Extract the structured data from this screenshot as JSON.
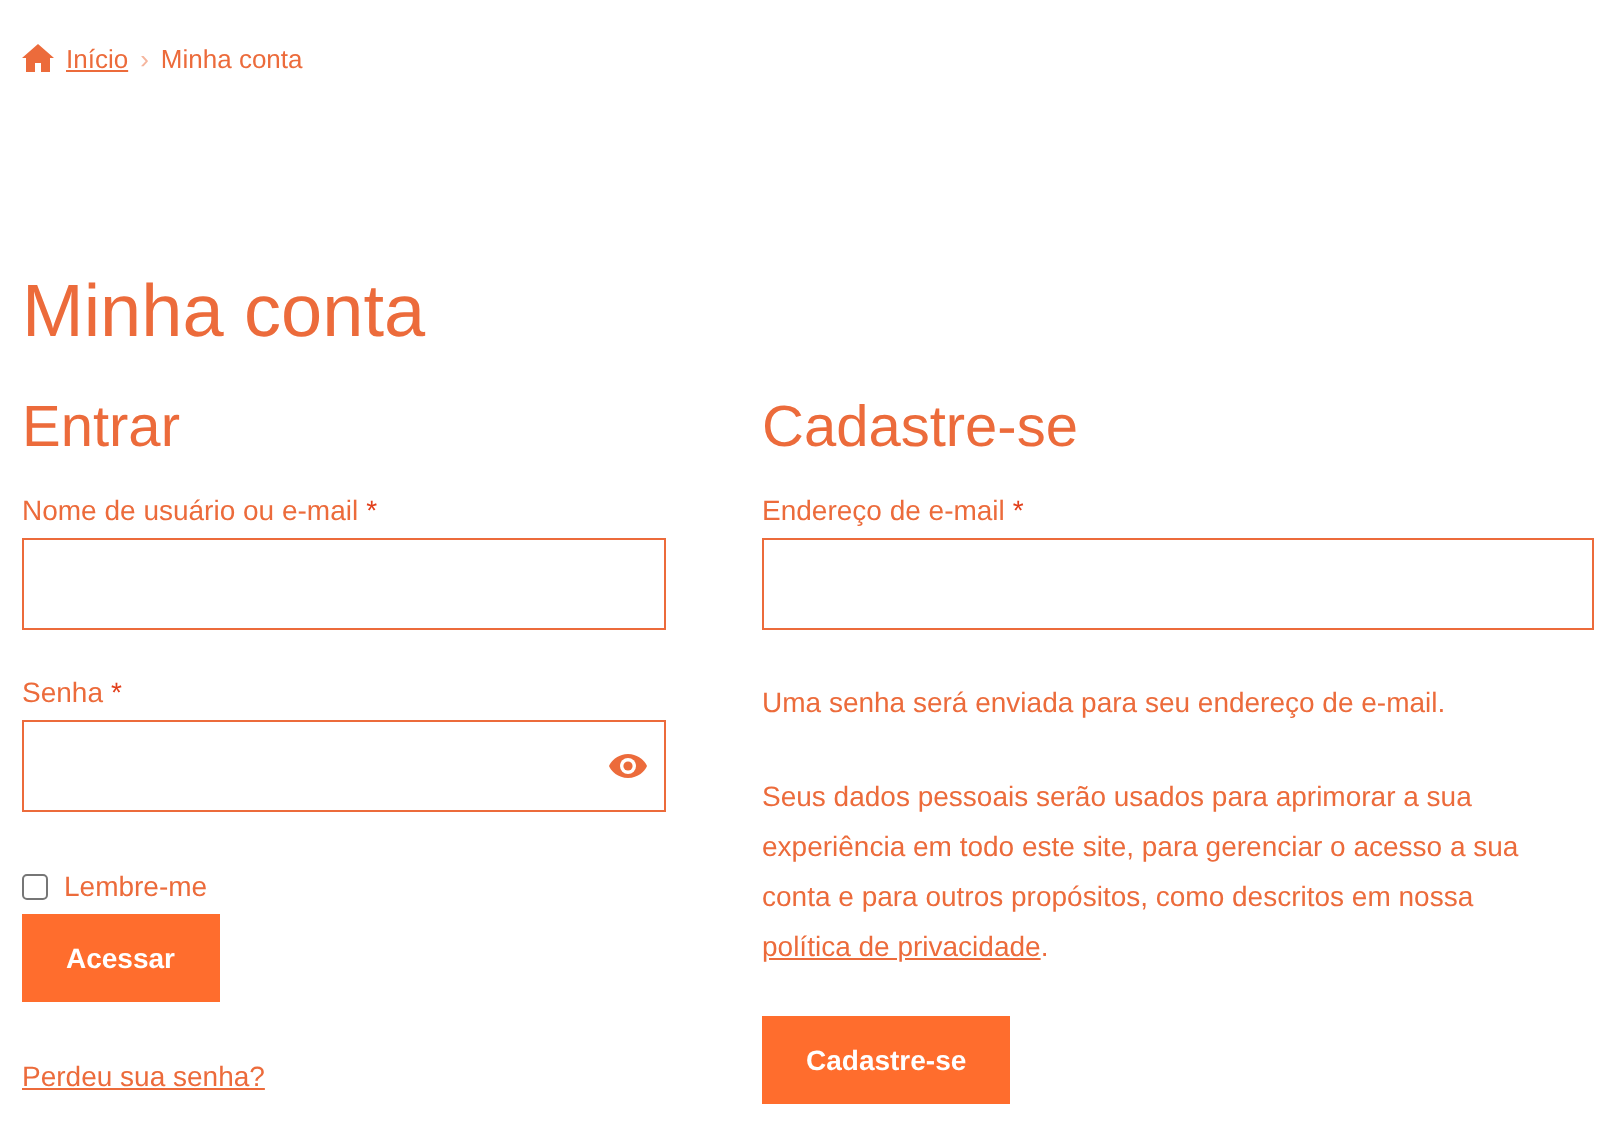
{
  "breadcrumb": {
    "home": "Início",
    "separator": "›",
    "current": "Minha conta"
  },
  "title": "Minha conta",
  "login": {
    "heading": "Entrar",
    "fields": [
      {
        "label": "Nome de usuário ou e-mail",
        "required_mark": "*",
        "kind": "text"
      },
      {
        "label": "Senha",
        "required_mark": "*",
        "kind": "password"
      }
    ],
    "remember": {
      "label": "Lembre-me",
      "checked": false
    },
    "button": "Acessar",
    "lost_password": "Perdeu sua senha?"
  },
  "register": {
    "heading": "Cadastre-se",
    "fields": [
      {
        "label": "Endereço de e-mail",
        "required_mark": "*",
        "kind": "email"
      }
    ],
    "note": "Uma senha será enviada para seu endereço de e-mail.",
    "privacy": {
      "text": "Seus dados pessoais serão usados para aprimorar a sua experiência em todo este site, para gerenciar o acesso a sua conta e para outros propósitos, como descritos em nossa ",
      "link": "política de privacidade",
      "after": "."
    },
    "button": "Cadastre-se"
  }
}
